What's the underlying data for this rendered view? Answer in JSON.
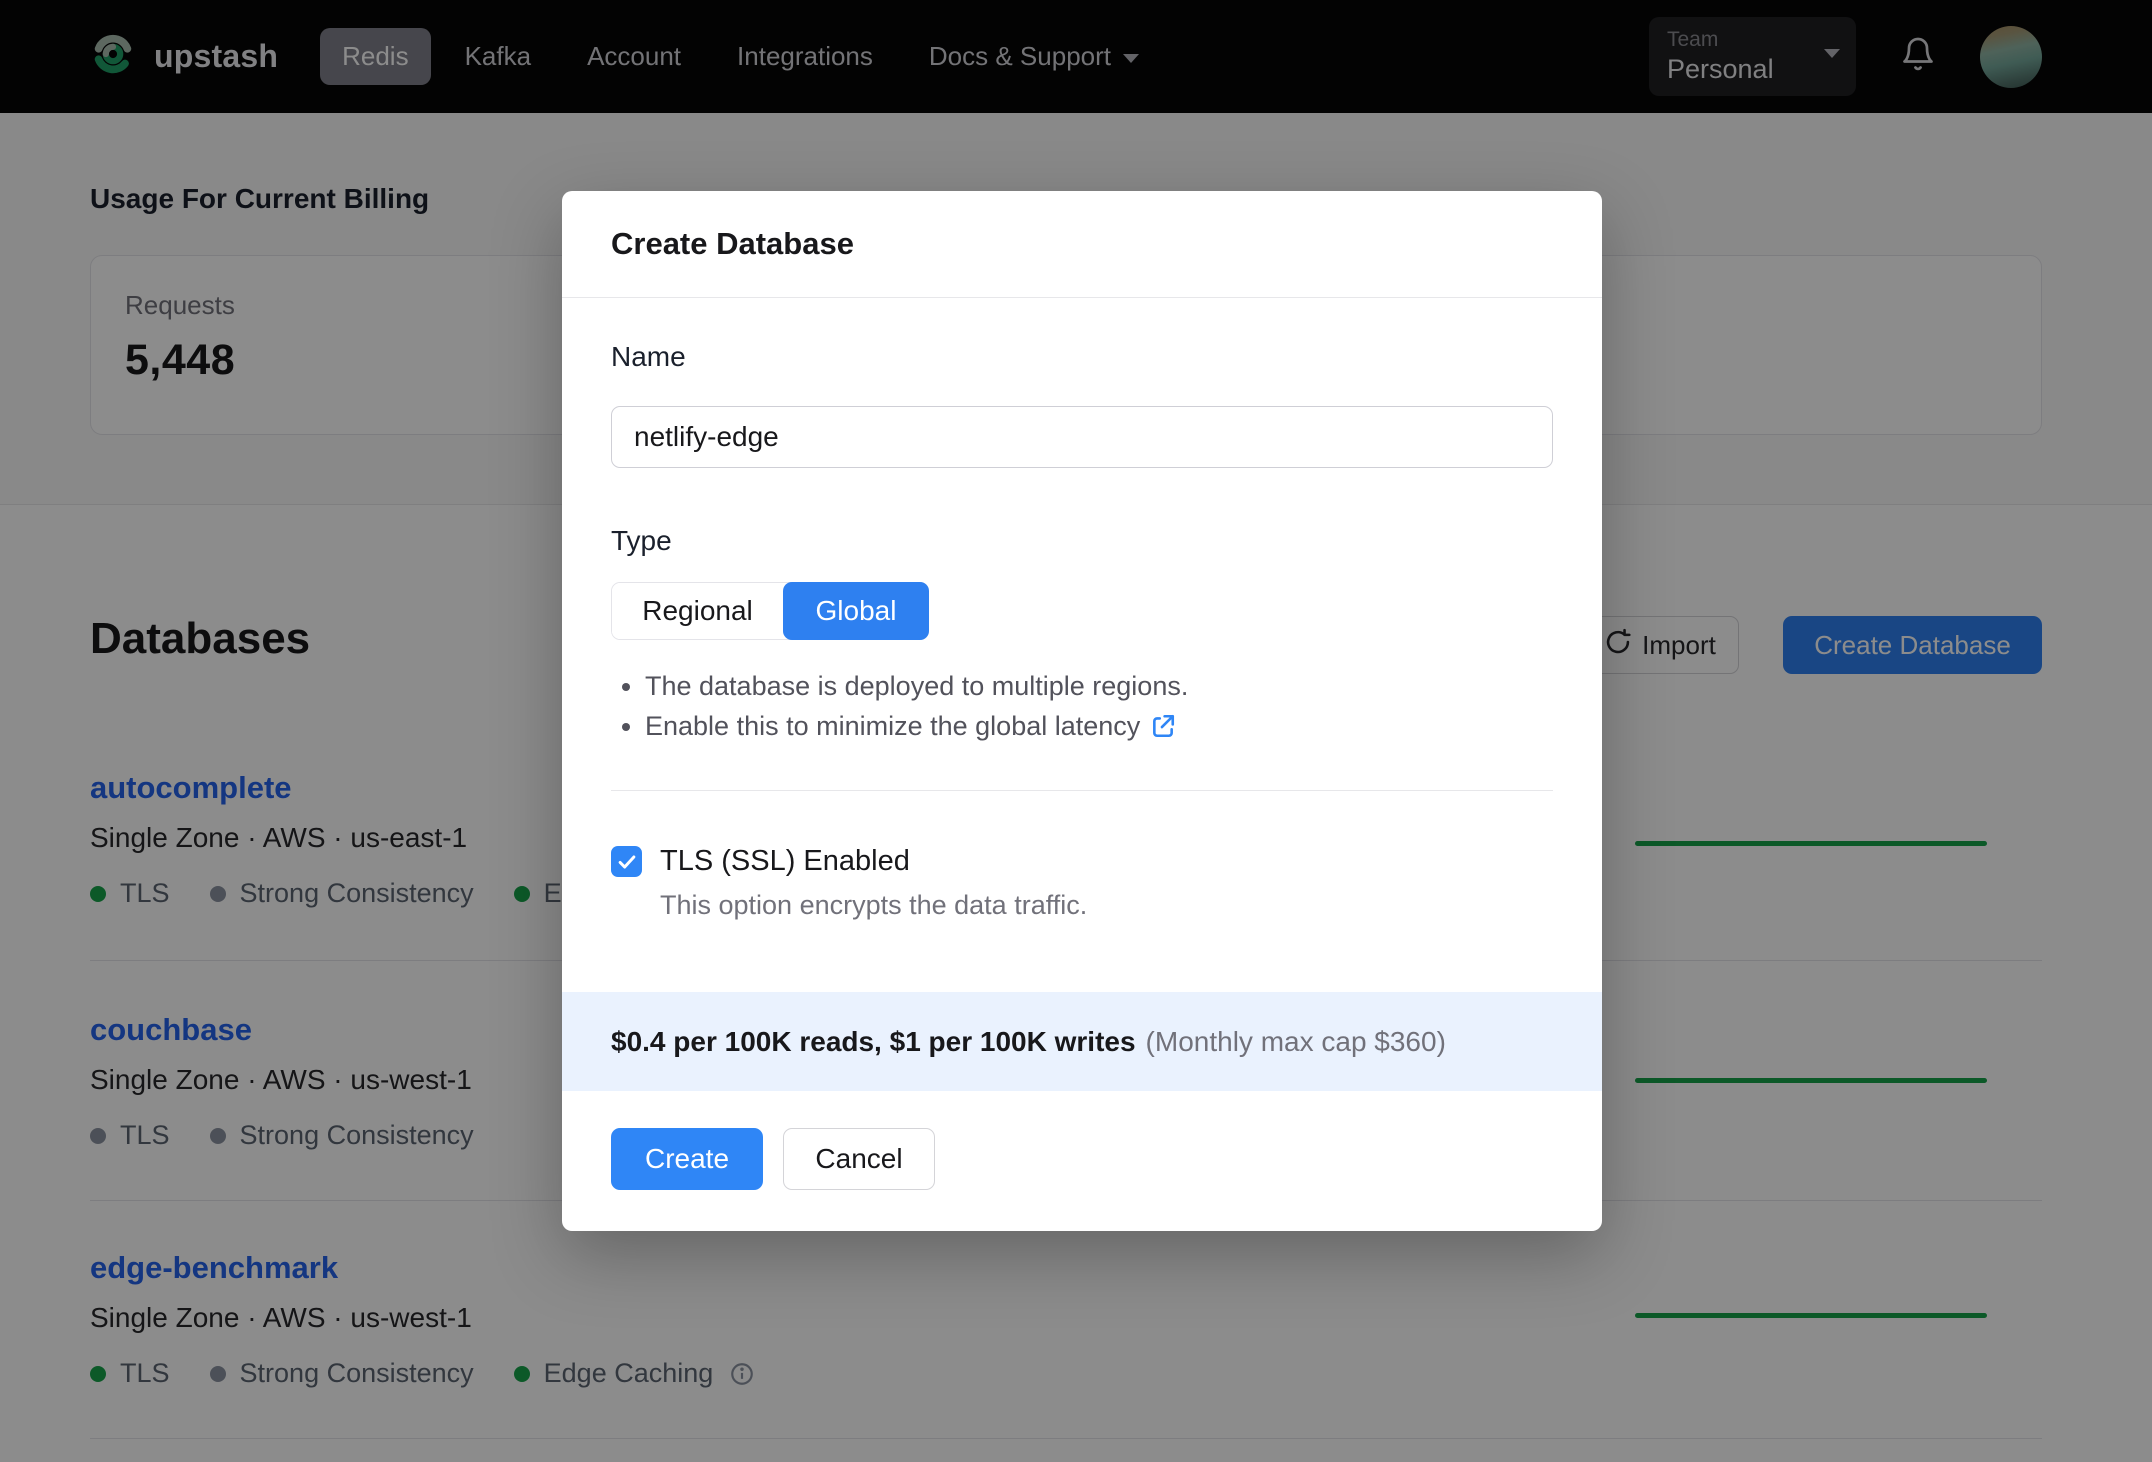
{
  "nav": {
    "brand": "upstash",
    "items": [
      {
        "label": "Redis",
        "active": true
      },
      {
        "label": "Kafka",
        "active": false
      },
      {
        "label": "Account",
        "active": false
      },
      {
        "label": "Integrations",
        "active": false
      },
      {
        "label": "Docs & Support",
        "active": false,
        "has_caret": true
      }
    ],
    "team": {
      "label": "Team",
      "value": "Personal"
    }
  },
  "usage": {
    "heading": "Usage For Current Billing",
    "requests_label": "Requests",
    "requests_value": "5,448"
  },
  "databases": {
    "heading": "Databases",
    "import_label": "Import",
    "create_label": "Create Database",
    "rows": [
      {
        "name": "autocomplete",
        "subtitle": "Single Zone · AWS · us-east-1",
        "badges": [
          {
            "label": "TLS",
            "color": "green"
          },
          {
            "label": "Strong Consistency",
            "color": "gray"
          },
          {
            "label": "Edge Caching",
            "color": "green",
            "info": true
          }
        ]
      },
      {
        "name": "couchbase",
        "subtitle": "Single Zone · AWS · us-west-1",
        "badges": [
          {
            "label": "TLS",
            "color": "gray"
          },
          {
            "label": "Strong Consistency",
            "color": "gray"
          }
        ]
      },
      {
        "name": "edge-benchmark",
        "subtitle": "Single Zone · AWS · us-west-1",
        "badges": [
          {
            "label": "TLS",
            "color": "green"
          },
          {
            "label": "Strong Consistency",
            "color": "gray"
          },
          {
            "label": "Edge Caching",
            "color": "green",
            "info": true
          }
        ]
      }
    ]
  },
  "modal": {
    "title": "Create Database",
    "name_label": "Name",
    "name_value": "netlify-edge",
    "type_label": "Type",
    "type_options": [
      {
        "label": "Regional",
        "active": false
      },
      {
        "label": "Global",
        "active": true
      }
    ],
    "bullets": [
      "The database is deployed to multiple regions.",
      "Enable this to minimize the global latency"
    ],
    "tls_label": "TLS (SSL) Enabled",
    "tls_desc": "This option encrypts the data traffic.",
    "tls_checked": true,
    "pricing_bold": "$0.4 per 100K reads, $1 per 100K writes",
    "pricing_note": "(Monthly max cap $360)",
    "create_label": "Create",
    "cancel_label": "Cancel"
  },
  "colors": {
    "accent_blue": "#2f86f6",
    "link_blue": "#2563eb",
    "status_green": "#17a34a",
    "status_gray": "#8b93a0",
    "banner_bg": "#eaf2fe",
    "overlay": "rgba(0,0,0,0.45)"
  }
}
